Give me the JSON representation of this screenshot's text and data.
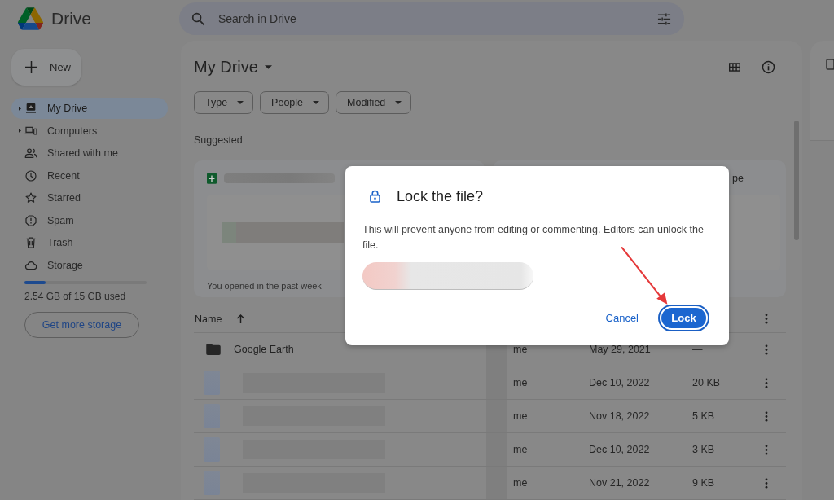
{
  "header": {
    "app_name": "Drive",
    "search": {
      "placeholder": "Search in Drive"
    }
  },
  "sidebar": {
    "new_button": "New",
    "items": [
      {
        "label": "My Drive",
        "caret": true,
        "selected": true
      },
      {
        "label": "Computers",
        "caret": true,
        "selected": false
      },
      {
        "label": "Shared with me",
        "caret": false,
        "selected": false
      },
      {
        "label": "Recent",
        "caret": false,
        "selected": false
      },
      {
        "label": "Starred",
        "caret": false,
        "selected": false
      },
      {
        "label": "Spam",
        "caret": false,
        "selected": false
      },
      {
        "label": "Trash",
        "caret": false,
        "selected": false
      },
      {
        "label": "Storage",
        "caret": false,
        "selected": false
      }
    ],
    "storage": {
      "level": 0.17,
      "usage": "2.54 GB of 15 GB used",
      "button": "Get more storage"
    }
  },
  "main": {
    "title": "My Drive",
    "filters": [
      "Type",
      "People",
      "Modified"
    ],
    "suggested": {
      "heading": "Suggested",
      "cards": [
        {
          "kind": "spreadsheet",
          "caption": "You opened in the past week"
        },
        {
          "kind": "hidden",
          "title": "pe"
        }
      ]
    },
    "table": {
      "columns": [
        {
          "label": "Name",
          "sort_ascending": true
        }
      ],
      "rows": [
        {
          "kind": "folder",
          "name": "Google Earth",
          "owner": "me",
          "modified": "May 29, 2021",
          "size": "—"
        },
        {
          "kind": "blurred",
          "owner": "me",
          "modified": "Dec 10, 2022",
          "size": "20 KB"
        },
        {
          "kind": "blurred",
          "owner": "me",
          "modified": "Nov 18, 2022",
          "size": "5 KB"
        },
        {
          "kind": "blurred",
          "owner": "me",
          "modified": "Dec 10, 2022",
          "size": "3 KB"
        },
        {
          "kind": "blurred",
          "owner": "me",
          "modified": "Nov 21, 2022",
          "size": "9 KB"
        }
      ]
    }
  },
  "dialog": {
    "title": "Lock the file?",
    "body": "This will prevent anyone from editing or commenting. Editors can unlock the file.",
    "buttons": [
      {
        "label": "Cancel",
        "kind": "text",
        "focused": false
      },
      {
        "label": "Lock",
        "kind": "filled",
        "focused": true
      }
    ]
  }
}
